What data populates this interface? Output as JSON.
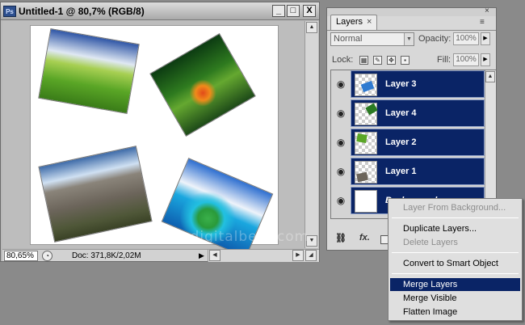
{
  "document_window": {
    "app_icon_label": "Ps",
    "title": "Untitled-1 @ 80,7% (RGB/8)",
    "minimize_label": "_",
    "maximize_label": "□",
    "close_label": "X",
    "status": {
      "zoom": "80,65%",
      "doc_size": "Doc: 371,8K/2,02M"
    }
  },
  "layers_panel": {
    "tab_label": "Layers",
    "tab_close": "×",
    "close_label": "×",
    "menu_icon": "≡",
    "blend_mode": "Normal",
    "opacity_label": "Opacity:",
    "opacity_value": "100%",
    "lock_label": "Lock:",
    "fill_label": "Fill:",
    "fill_value": "100%",
    "layers": [
      {
        "name": "Layer 3",
        "selected": true
      },
      {
        "name": "Layer 4",
        "selected": true
      },
      {
        "name": "Layer 2",
        "selected": true
      },
      {
        "name": "Layer 1",
        "selected": true
      },
      {
        "name": "Background",
        "selected": true
      }
    ],
    "bottom_icons": [
      "link-icon",
      "fx-icon",
      "mask-icon"
    ],
    "bottom_labels": {
      "link": "⛓",
      "fx": "fx."
    }
  },
  "context_menu": {
    "items": [
      {
        "label": "Layer From Background...",
        "disabled": true
      },
      {
        "label": "Duplicate Layers...",
        "disabled": false
      },
      {
        "label": "Delete Layers",
        "disabled": true
      },
      {
        "label": "Convert to Smart Object",
        "disabled": false
      },
      {
        "label": "Merge Layers",
        "disabled": false,
        "highlighted": true
      },
      {
        "label": "Merge Visible",
        "disabled": false
      },
      {
        "label": "Flatten Image",
        "disabled": false
      }
    ]
  },
  "colors": {
    "selection": "#0a2466",
    "window_bg": "#b9b9b9",
    "desktop": "#8a8a8a"
  }
}
